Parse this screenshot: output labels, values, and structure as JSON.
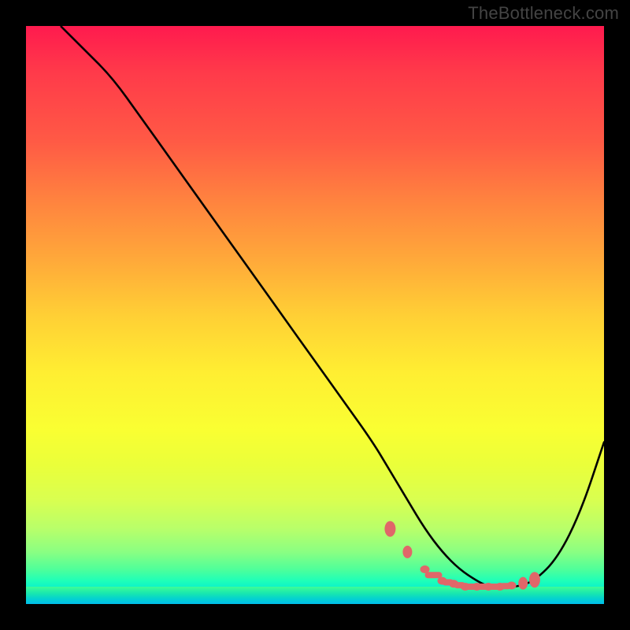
{
  "watermark": "TheBottleneck.com",
  "chart_data": {
    "type": "line",
    "title": "",
    "xlabel": "",
    "ylabel": "",
    "xlim": [
      0,
      100
    ],
    "ylim": [
      0,
      100
    ],
    "grid": false,
    "legend": false,
    "series": [
      {
        "name": "bottleneck-curve",
        "x": [
          6,
          10,
          15,
          20,
          25,
          30,
          35,
          40,
          45,
          50,
          55,
          60,
          63,
          66,
          69,
          72,
          75,
          78,
          80,
          83,
          85,
          88,
          92,
          96,
          100
        ],
        "y": [
          100,
          96,
          91,
          84,
          77,
          70,
          63,
          56,
          49,
          42,
          35,
          28,
          23,
          18,
          13,
          9,
          6,
          4,
          3,
          3,
          3,
          4,
          8,
          16,
          28
        ]
      }
    ],
    "markers": {
      "name": "highlight-dots",
      "x": [
        63,
        66,
        69,
        72,
        74,
        76,
        78,
        80,
        82,
        84,
        86,
        88
      ],
      "y": [
        13,
        9,
        6,
        4,
        3.5,
        3,
        3,
        3,
        3,
        3.2,
        3.6,
        4.2
      ]
    },
    "colors": {
      "curve": "#000000",
      "markers": "#e06769",
      "gradient_top": "#ff1a4e",
      "gradient_mid": "#ffe433",
      "gradient_bottom": "#00c8f0"
    }
  }
}
